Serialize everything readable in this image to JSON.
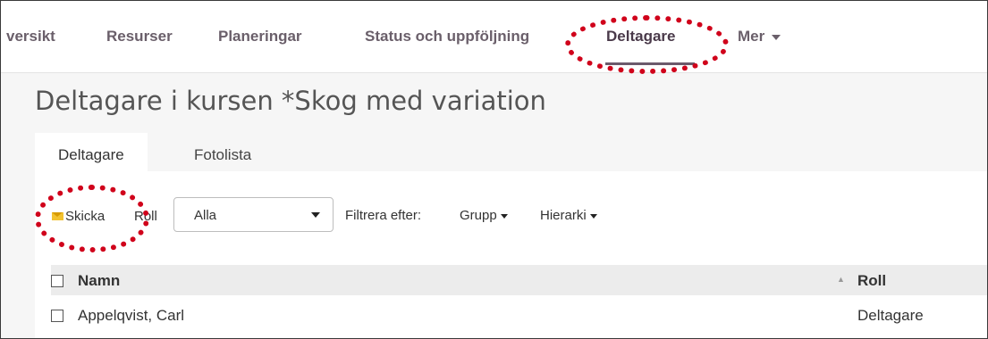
{
  "nav": {
    "items": [
      "versikt",
      "Resurser",
      "Planeringar",
      "Status och uppföljning",
      "Deltagare"
    ],
    "more_label": "Mer",
    "active": "Deltagare"
  },
  "page": {
    "title": "Deltagare i kursen *Skog med variation"
  },
  "tabs": [
    "Deltagare",
    "Fotolista"
  ],
  "toolbar": {
    "send_label": "Skicka",
    "role_label": "Roll",
    "role_value": "Alla",
    "filter_label": "Filtrera efter:",
    "group_label": "Grupp",
    "hierarchy_label": "Hierarki"
  },
  "table": {
    "columns": [
      "Namn",
      "Roll"
    ],
    "rows": [
      {
        "name": "Appelqvist, Carl",
        "role": "Deltagare"
      }
    ]
  },
  "colors": {
    "nav_text": "#6a5f6a",
    "active_underline": "#6b5a6b",
    "callout": "#d0021b",
    "mail_icon": "#f2c230"
  }
}
